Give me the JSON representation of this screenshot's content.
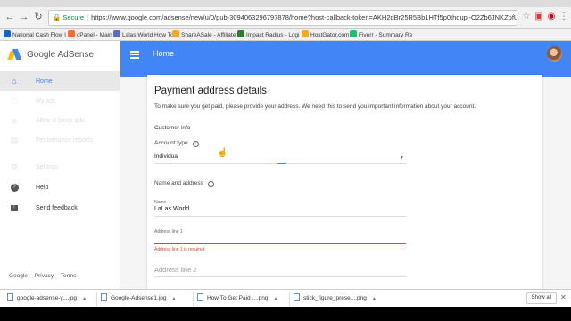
{
  "browser": {
    "secure_label": "Secure",
    "url": "https://www.google.com/adsense/new/u/0/pub-3094063296797878/home?host-callback-token=AKH2dBr25R5Bb1HTf5p0thqupi-O2Zb6JNKZpfUHvt9hQuvPUv3BR...",
    "bookmarks": [
      {
        "label": "National Cash Flow I",
        "color": "#1565c0"
      },
      {
        "label": "cPanel - Main",
        "color": "#ff6c2c"
      },
      {
        "label": "Lalas World How To",
        "color": "#5c6bc0"
      },
      {
        "label": "ShareASale - Affiliate",
        "color": "#f9a825"
      },
      {
        "label": "Impact Radius - Logi",
        "color": "#2e7d32"
      },
      {
        "label": "HostGator.com",
        "color": "#f9a825"
      },
      {
        "label": "Fiverr - Summary Re",
        "color": "#1dbf73"
      }
    ]
  },
  "sidebar": {
    "logo_text": "Google AdSense",
    "items": [
      {
        "label": "Home",
        "icon": "home-icon"
      },
      {
        "label": "My ads",
        "icon": "ads-icon"
      },
      {
        "label": "Allow & block ads",
        "icon": "block-icon"
      },
      {
        "label": "Performance reports",
        "icon": "reports-icon"
      },
      {
        "label": "Settings",
        "icon": "settings-icon"
      },
      {
        "label": "Help",
        "icon": "help-icon"
      },
      {
        "label": "Send feedback",
        "icon": "feedback-icon"
      }
    ],
    "footer": {
      "google": "Google",
      "privacy": "Privacy",
      "terms": "Terms"
    }
  },
  "header": {
    "title": "Home"
  },
  "card": {
    "title": "Payment address details",
    "description": "To make sure you get paid, please provide your address. We need this to send you important information about your account.",
    "customer_info": "Customer info",
    "account_type_label": "Account type",
    "account_type_value": "Individual",
    "name_address_label": "Name and address",
    "name_label": "Name",
    "name_value": "LaLas World",
    "address1_label": "Address line 1",
    "address1_error": "Address line 1 is required",
    "address2_placeholder": "Address line 2"
  },
  "downloads": {
    "items": [
      {
        "label": "google-adsense-y....jpg"
      },
      {
        "label": "Google-Adsense1.jpg"
      },
      {
        "label": "How To Get Paid ....png"
      },
      {
        "label": "stick_figure_prese....png"
      }
    ],
    "show_all": "Show all"
  },
  "colors": {
    "brand_blue": "#4285f4",
    "error_red": "#db4437"
  }
}
